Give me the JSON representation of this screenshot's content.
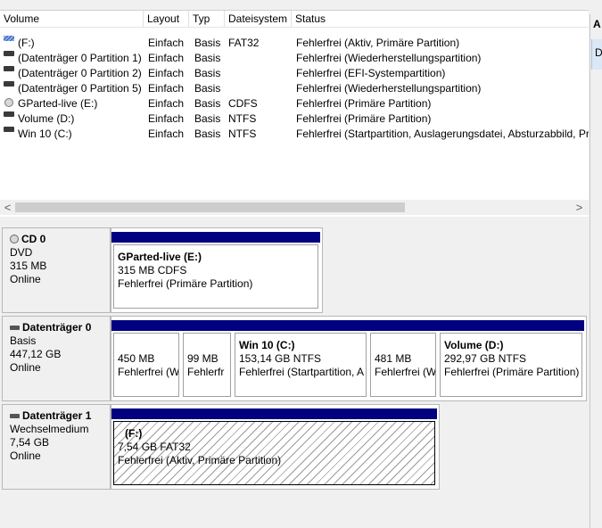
{
  "columns": [
    "Volume",
    "Layout",
    "Typ",
    "Dateisystem",
    "Status"
  ],
  "volumes": [
    {
      "icon": "removable-drive-icon",
      "volume": "(F:)",
      "layout": "Einfach",
      "typ": "Basis",
      "fs": "FAT32",
      "status": "Fehlerfrei (Aktiv, Primäre Partition)"
    },
    {
      "icon": "disk-volume-icon",
      "volume": "(Datenträger 0 Partition 1)",
      "layout": "Einfach",
      "typ": "Basis",
      "fs": "",
      "status": "Fehlerfrei (Wiederherstellungspartition)"
    },
    {
      "icon": "disk-volume-icon",
      "volume": "(Datenträger 0 Partition 2)",
      "layout": "Einfach",
      "typ": "Basis",
      "fs": "",
      "status": "Fehlerfrei (EFI-Systempartition)"
    },
    {
      "icon": "disk-volume-icon",
      "volume": "(Datenträger 0 Partition 5)",
      "layout": "Einfach",
      "typ": "Basis",
      "fs": "",
      "status": "Fehlerfrei (Wiederherstellungspartition)"
    },
    {
      "icon": "cd-drive-icon",
      "volume": "GParted-live (E:)",
      "layout": "Einfach",
      "typ": "Basis",
      "fs": "CDFS",
      "status": "Fehlerfrei (Primäre Partition)"
    },
    {
      "icon": "disk-volume-icon",
      "volume": "Volume (D:)",
      "layout": "Einfach",
      "typ": "Basis",
      "fs": "NTFS",
      "status": "Fehlerfrei (Primäre Partition)"
    },
    {
      "icon": "disk-volume-icon",
      "volume": "Win 10 (C:)",
      "layout": "Einfach",
      "typ": "Basis",
      "fs": "NTFS",
      "status": "Fehlerfrei (Startpartition, Auslagerungsdatei, Absturzabbild, Pr"
    }
  ],
  "scroll": {
    "left": "<",
    "right": ">"
  },
  "disks": {
    "cd0": {
      "name": "CD 0",
      "type": "DVD",
      "size": "315 MB",
      "state": "Online",
      "partitions": [
        {
          "name": "GParted-live  (E:)",
          "size": "315 MB CDFS",
          "status": "Fehlerfrei (Primäre Partition)"
        }
      ]
    },
    "disk0": {
      "name": "Datenträger 0",
      "type": "Basis",
      "size": "447,12 GB",
      "state": "Online",
      "partitions": [
        {
          "name": "",
          "size": "450 MB",
          "status": "Fehlerfrei (W"
        },
        {
          "name": "",
          "size": "99 MB",
          "status": "Fehlerfr"
        },
        {
          "name": "Win 10  (C:)",
          "size": "153,14 GB NTFS",
          "status": "Fehlerfrei (Startpartition, A"
        },
        {
          "name": "",
          "size": "481 MB",
          "status": "Fehlerfrei (W"
        },
        {
          "name": "Volume  (D:)",
          "size": "292,97 GB NTFS",
          "status": "Fehlerfrei (Primäre Partition)"
        }
      ]
    },
    "disk1": {
      "name": "Datenträger 1",
      "type": "Wechselmedium",
      "size": "7,54 GB",
      "state": "Online",
      "partitions": [
        {
          "name": "(F:)",
          "size": "7,54 GB FAT32",
          "status": "Fehlerfrei (Aktiv, Primäre Partition)"
        }
      ]
    }
  },
  "actions": {
    "header": "A",
    "selected": "D"
  },
  "colors": {
    "partition_bar": "#000080",
    "background": "#f0f0f0"
  }
}
